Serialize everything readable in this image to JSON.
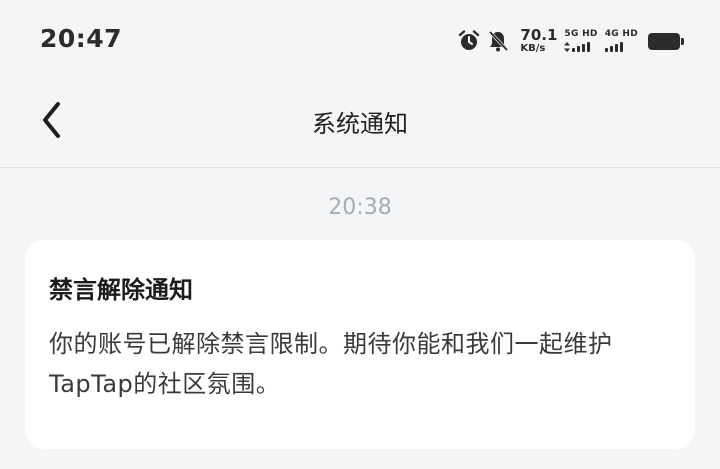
{
  "status_bar": {
    "time": "20:47",
    "speed_value": "70.1",
    "speed_unit": "KB/s",
    "sim1_label": "5G HD",
    "sim2_label": "4G HD",
    "icons": [
      "alarm-icon",
      "mute-bell-icon",
      "signal-icon",
      "battery-icon"
    ]
  },
  "nav": {
    "title": "系统通知",
    "back_icon": "chevron-left-icon"
  },
  "message": {
    "time": "20:38",
    "title": "禁言解除通知",
    "body": "你的账号已解除禁言限制。期待你能和我们一起维护TapTap的社区氛围。"
  },
  "colors": {
    "background": "#f4f5f7",
    "card": "#ffffff",
    "timestamp": "#a7abb3",
    "text": "#1f1f1f"
  }
}
